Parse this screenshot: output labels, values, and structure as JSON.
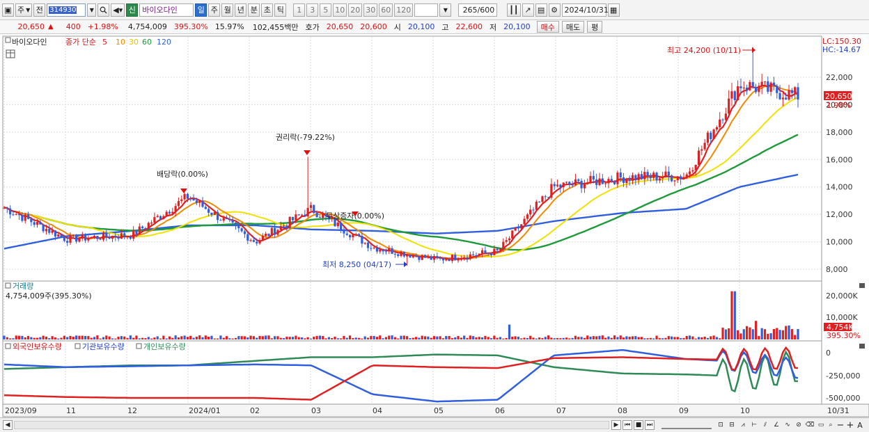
{
  "toolbar": {
    "market": "주",
    "prev": "전",
    "code": "314930",
    "sin": "신",
    "stock_name": "바이오다인",
    "periods": [
      "일",
      "주",
      "월",
      "년",
      "분",
      "초",
      "틱"
    ],
    "intervals": [
      "1",
      "3",
      "5",
      "10",
      "20",
      "30",
      "60",
      "120"
    ],
    "count": "265",
    "count_max": "/600",
    "date": "2024/10/31"
  },
  "quote": {
    "price": "20,650",
    "change": "400",
    "change_pct": "+1.98%",
    "volume": "4,754,009",
    "vol_ratio": "395.30%",
    "turnover": "15.97%",
    "amount": "102,455백만",
    "bid_label": "호가",
    "ask": "20,650",
    "bid": "20,600",
    "open_label": "시",
    "open": "20,100",
    "high_label": "고",
    "high": "22,600",
    "low_label": "저",
    "low": "20,100",
    "buy_label": "매수",
    "sell_label": "매도",
    "pyung_label": "평"
  },
  "price_panel": {
    "stock_label": "바이오다인",
    "legend_prefix": "종가 단순",
    "ma_periods": [
      "5",
      "10",
      "30",
      "60",
      "120"
    ],
    "ma_colors": [
      "#e02020",
      "#f08a00",
      "#f2e000",
      "#1e9a3a",
      "#2f5fe0"
    ],
    "lc": "LC:150.30",
    "hc": "HC:-14.67",
    "y_ticks": [
      "22,000",
      "20,000",
      "18,000",
      "16,000",
      "14,000",
      "12,000",
      "10,000",
      "8,000"
    ],
    "price_tag": "20,650",
    "pct_tag": "1.98%",
    "annotations": {
      "high": "최고 24,200 (10/11)",
      "low": "최저 8,250 (04/17)",
      "dividend": "배당락(0.00%)",
      "rights": "권리락(-79.22%)",
      "bonus": "무상증자(0.00%)"
    }
  },
  "volume_panel": {
    "title": "거래량",
    "value": "4,754,009주(395.30%)",
    "y_ticks": [
      "20,000K",
      "10,000K"
    ],
    "tag": "4,754K",
    "tag_pct": "395.30%"
  },
  "holdings_panel": {
    "series": [
      "외국인보유수량",
      "기관보유수량",
      "개인보유수량"
    ],
    "colors": [
      "#e02020",
      "#2f5fe0",
      "#2e8b57"
    ],
    "y_ticks": [
      "0",
      "-250,000",
      "-500,000"
    ]
  },
  "x_axis": {
    "labels": [
      "2023/09",
      "11",
      "12",
      "2024/01",
      "02",
      "03",
      "04",
      "05",
      "06",
      "07",
      "08",
      "09",
      "10"
    ],
    "end_label": "10/31"
  },
  "chart_data": {
    "type": "candlestick",
    "price_range": [
      7500,
      24500
    ],
    "price_series_approx": {
      "x": [
        "2023/09",
        "11",
        "12",
        "2024/01",
        "02",
        "03",
        "04",
        "05",
        "06",
        "07",
        "08",
        "09",
        "10",
        "10/31"
      ],
      "close": [
        12500,
        10200,
        10500,
        13300,
        10000,
        12400,
        9600,
        8700,
        9300,
        14000,
        14700,
        14800,
        21500,
        20650
      ]
    },
    "ma120_approx": [
      9500,
      10400,
      10800,
      11200,
      11200,
      10900,
      10800,
      10600,
      10800,
      11500,
      12100,
      12400,
      14000,
      14900
    ],
    "volume_range_k": [
      0,
      25000
    ],
    "holdings_range": [
      -560000,
      40000
    ]
  }
}
